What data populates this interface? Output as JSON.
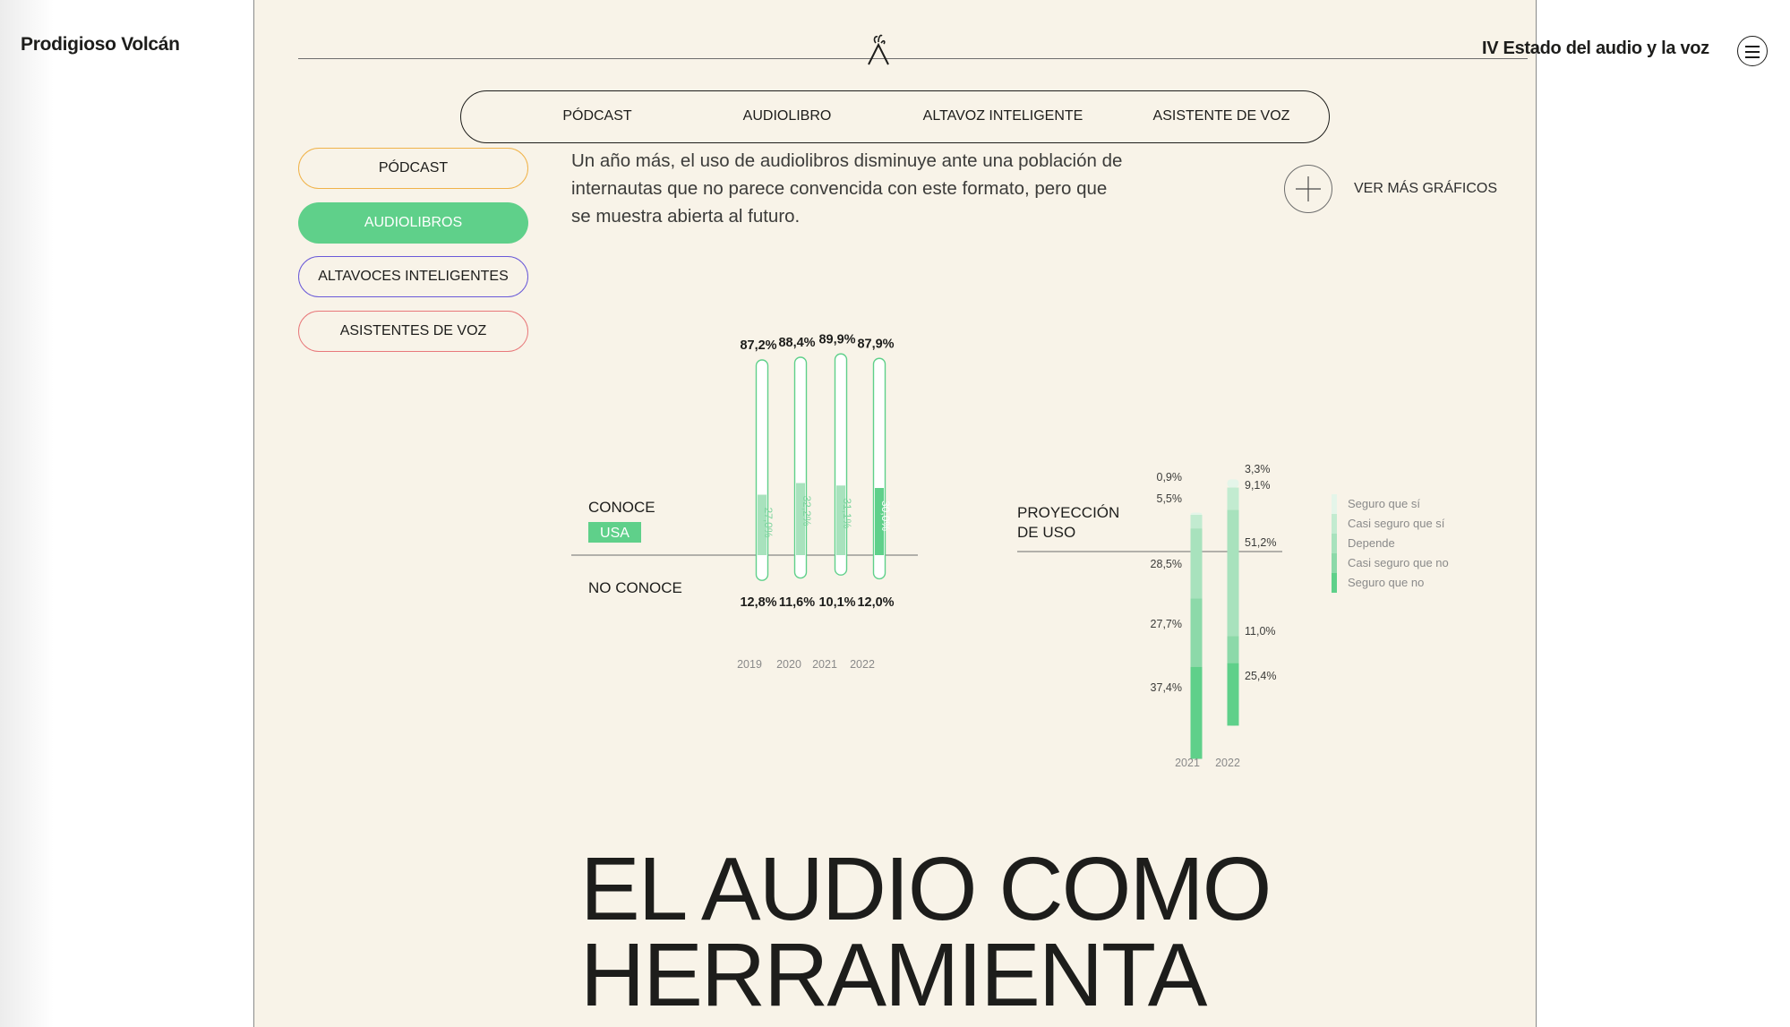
{
  "brand": "Prodigioso Volcán",
  "report_title": "IV Estado del audio y la voz",
  "topnav": [
    "PÓDCAST",
    "AUDIOLIBRO",
    "ALTAVOZ INTELIGENTE",
    "ASISTENTE DE VOZ"
  ],
  "side_pills": [
    {
      "label": "PÓDCAST",
      "border": "#f0b34a",
      "active": false
    },
    {
      "label": "AUDIOLIBROS",
      "border": "#5fd08a",
      "active": true
    },
    {
      "label": "ALTAVOCES INTELIGENTES",
      "border": "#6a5ad8",
      "active": false
    },
    {
      "label": "ASISTENTES DE VOZ",
      "border": "#e8787a",
      "active": false
    }
  ],
  "intro": "Un año más, el uso de audiolibros disminuye ante una población de internautas que no parece convencida con este formato, pero que se muestra abierta al futuro.",
  "more_charts": "VER MÁS GRÁFICOS",
  "headline": [
    "EL AUDIO COMO",
    "HERRAMIENTA"
  ],
  "colors": {
    "accent": "#5fd08a",
    "panel_bg": "#f8f3e8"
  },
  "chart_data": [
    {
      "type": "bar",
      "categories": [
        "2019",
        "2020",
        "2021",
        "2022"
      ],
      "series": [
        {
          "name": "CONOCE",
          "values": [
            87.2,
            88.4,
            89.9,
            87.9
          ],
          "labels": [
            "87,2%",
            "88,4%",
            "89,9%",
            "87,9%"
          ]
        },
        {
          "name": "USA",
          "values": [
            27.0,
            32.2,
            31.1,
            30.0
          ],
          "labels": [
            "27,0%",
            "32,2%",
            "31,1%",
            "30,0%"
          ]
        },
        {
          "name": "NO CONOCE",
          "values": [
            12.8,
            11.6,
            10.1,
            12.0
          ],
          "labels": [
            "12,8%",
            "11,6%",
            "10,1%",
            "12,0%"
          ]
        }
      ],
      "labels": {
        "conoce": "CONOCE",
        "usa": "USA",
        "no_conoce": "NO CONOCE"
      }
    },
    {
      "type": "bar",
      "stacked": true,
      "title": "PROYECCIÓN DE USO",
      "title_lines": [
        "PROYECCIÓN",
        "DE USO"
      ],
      "categories": [
        "2021",
        "2022"
      ],
      "series": [
        {
          "name": "Seguro que sí",
          "color": "#e4f5e9",
          "values": [
            0.9,
            3.3
          ],
          "labels": [
            "0,9%",
            "3,3%"
          ]
        },
        {
          "name": "Casi seguro que sí",
          "color": "#c2ebd0",
          "values": [
            5.5,
            9.1
          ],
          "labels": [
            "5,5%",
            "9,1%"
          ]
        },
        {
          "name": "Depende",
          "color": "#a8e2bd",
          "values": [
            28.5,
            51.2
          ],
          "labels": [
            "28,5%",
            "51,2%"
          ]
        },
        {
          "name": "Casi seguro que no",
          "color": "#8cd9a9",
          "values": [
            27.7,
            11.0
          ],
          "labels": [
            "27,7%",
            "11,0%"
          ]
        },
        {
          "name": "Seguro que no",
          "color": "#5fd08a",
          "values": [
            37.4,
            25.4
          ],
          "labels": [
            "37,4%",
            "25,4%"
          ]
        }
      ],
      "legend": "right"
    }
  ]
}
